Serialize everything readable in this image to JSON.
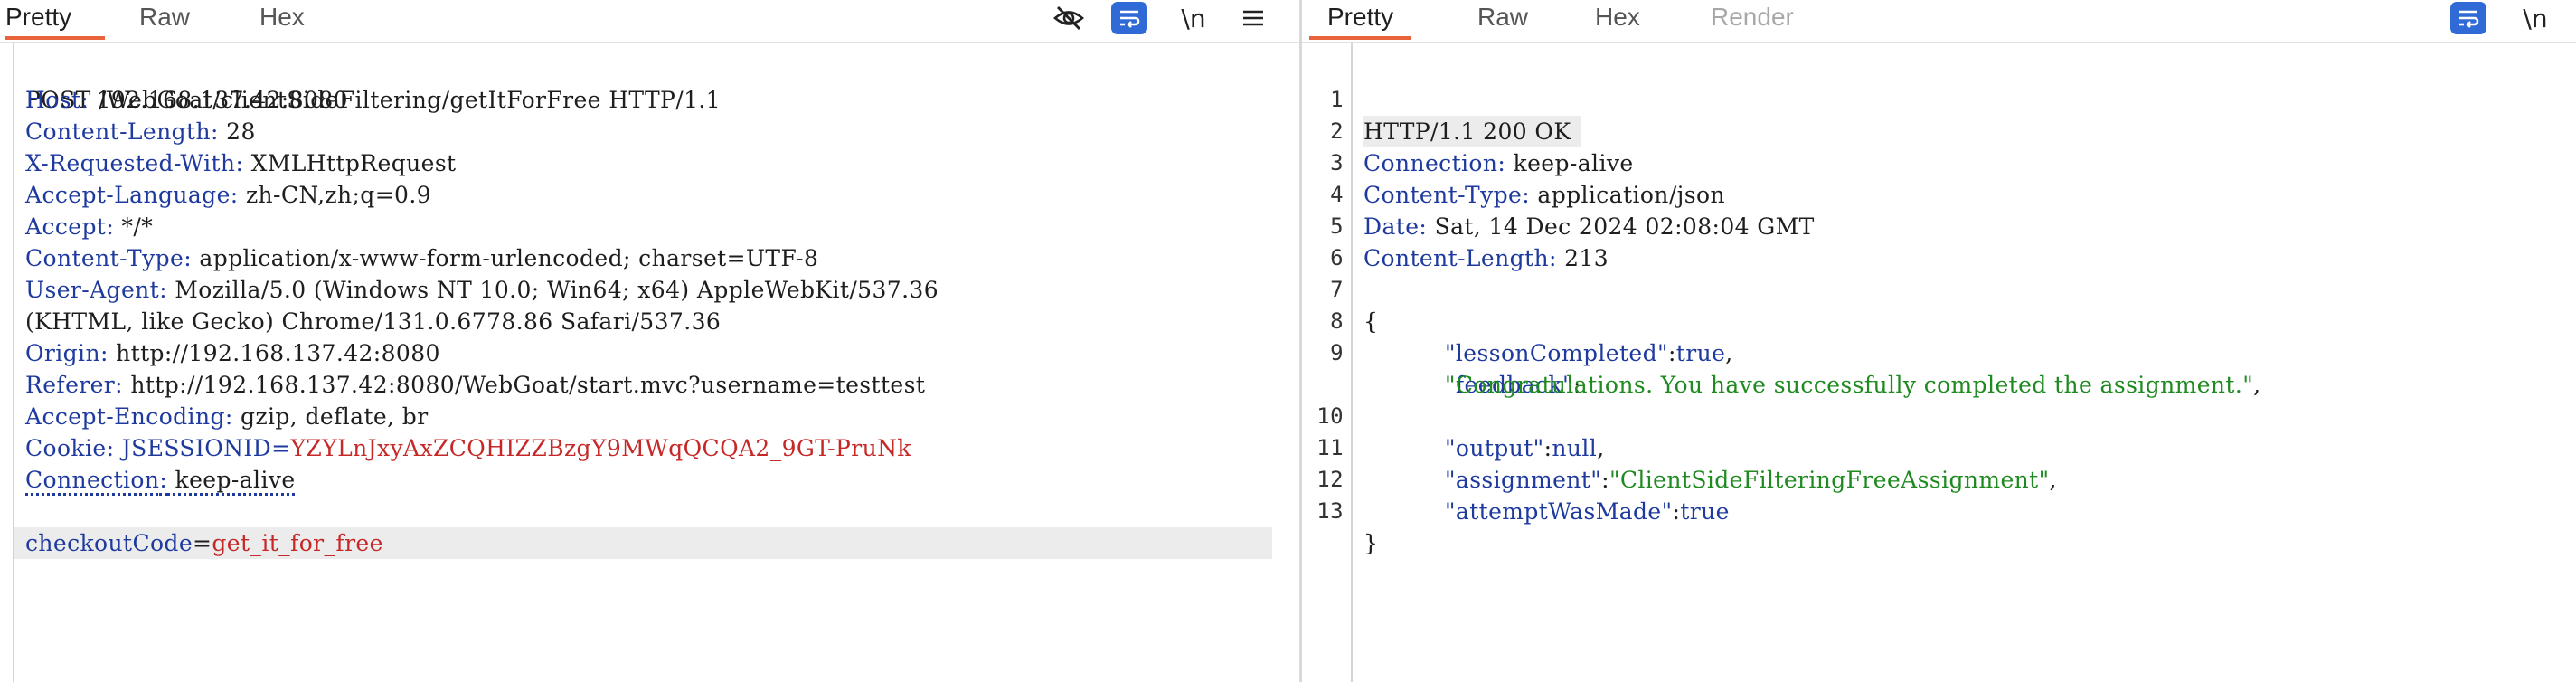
{
  "request_pane": {
    "tabs": [
      "Pretty",
      "Raw",
      "Hex"
    ],
    "active_tab": "Pretty",
    "toolbar": {
      "hide_icon": "eye-slash-icon",
      "wrap_icon": "wrap-lines-icon",
      "newline_label": "\\n",
      "menu_icon": "hamburger-menu-icon"
    },
    "request_line": "POST /WebGoat/clientSideFiltering/getItForFree HTTP/1.1",
    "headers": [
      {
        "name": "Host",
        "value": " 192.168.137.42:8080"
      },
      {
        "name": "Content-Length",
        "value": " 28"
      },
      {
        "name": "X-Requested-With",
        "value": " XMLHttpRequest"
      },
      {
        "name": "Accept-Language",
        "value": " zh-CN,zh;q=0.9"
      },
      {
        "name": "Accept",
        "value": " */*"
      },
      {
        "name": "Content-Type",
        "value": " application/x-www-form-urlencoded; charset=UTF-8"
      },
      {
        "name": "User-Agent",
        "value": " Mozilla/5.0 (Windows NT 10.0; Win64; x64) AppleWebKit/537.36"
      },
      {
        "name": "",
        "value": "(KHTML, like Gecko) Chrome/131.0.6778.86 Safari/537.36"
      },
      {
        "name": "Origin",
        "value": " http://192.168.137.42:8080"
      },
      {
        "name": "Referer",
        "value": " http://192.168.137.42:8080/WebGoat/start.mvc?username=testtest"
      },
      {
        "name": "Accept-Encoding",
        "value": " gzip, deflate, br"
      }
    ],
    "cookie": {
      "name": "Cookie",
      "cookie_key": "JSESSIONID",
      "cookie_value": "YZYLnJxyAxZCQHIZZBzgY9MWqQCQA2_9GT-PruNk"
    },
    "connection": {
      "name": "Connection",
      "value": " keep-alive"
    },
    "body": {
      "param": "checkoutCode",
      "value": "get_it_for_free"
    }
  },
  "response_pane": {
    "tabs": [
      "Pretty",
      "Raw",
      "Hex",
      "Render"
    ],
    "active_tab": "Pretty",
    "disabled_tab": "Render",
    "toolbar": {
      "wrap_icon": "wrap-lines-icon",
      "newline_label": "\\n"
    },
    "lines": [
      {
        "n": "1",
        "status": "HTTP/1.1 200 OK"
      },
      {
        "n": "2",
        "name": "Connection",
        "value": " keep-alive"
      },
      {
        "n": "3",
        "name": "Content-Type",
        "value": " application/json"
      },
      {
        "n": "4",
        "name": "Date",
        "value": " Sat, 14 Dec 2024 02:08:04 GMT"
      },
      {
        "n": "5",
        "name": "Content-Length",
        "value": " 213"
      },
      {
        "n": "6"
      },
      {
        "n": "7",
        "brace": "{"
      },
      {
        "n": "8",
        "key": "\"lessonCompleted\"",
        "sep": ":",
        "val": "true",
        "tail": ","
      },
      {
        "n": "9",
        "key": "\"feedback\"",
        "sep": ":"
      },
      {
        "n": "",
        "str": "\"Congratulations. You have successfully completed the assignment.\"",
        "tail": ","
      },
      {
        "n": "10",
        "key": "\"output\"",
        "sep": ":",
        "val": "null",
        "tail": ","
      },
      {
        "n": "11",
        "key": "\"assignment\"",
        "sep": ":",
        "str": "\"ClientSideFilteringFreeAssignment\"",
        "tail": ","
      },
      {
        "n": "12",
        "key": "\"attemptWasMade\"",
        "sep": ":",
        "val": "true"
      },
      {
        "n": "13",
        "brace": "}"
      }
    ]
  },
  "colors": {
    "header_name": "#1e3a9e",
    "cookie_value": "#c62828",
    "json_string": "#1f8a1f",
    "tab_active_underline": "#e8623a",
    "toolbar_active_button": "#2f6ad6"
  }
}
